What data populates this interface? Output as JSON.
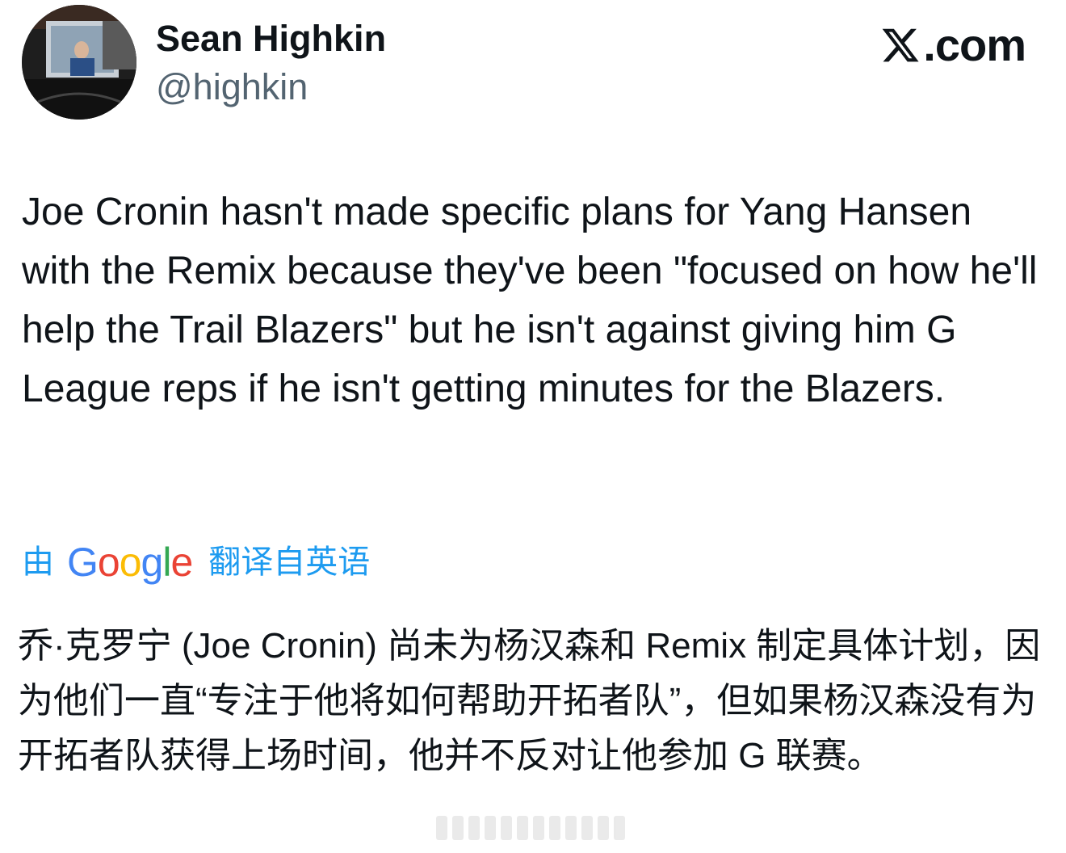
{
  "user": {
    "display_name": "Sean Highkin",
    "handle": "@highkin"
  },
  "brand": {
    "site": ".com",
    "logo_icon": "x-logo-icon"
  },
  "tweet": {
    "text": "Joe Cronin hasn't made specific plans for Yang Hansen with the Remix because they've been \"focused on how he'll help the Trail Blazers\" but he isn't against giving him G League reps if he isn't getting minutes for the Blazers."
  },
  "translation": {
    "prefix": "由",
    "provider_letters": [
      "G",
      "o",
      "o",
      "g",
      "l",
      "e"
    ],
    "suffix": "翻译自英语",
    "text": "乔·克罗宁 (Joe Cronin) 尚未为杨汉森和 Remix 制定具体计划，因为他们一直“专注于他将如何帮助开拓者队”，但如果杨汉森没有为开拓者队获得上场时间，他并不反对让他参加 G 联赛。"
  },
  "colors": {
    "text": "#0f1419",
    "handle": "#536471",
    "translate_link": "#1d9bf0",
    "google_blue": "#4285f4",
    "google_red": "#ea4335",
    "google_yellow": "#fbbc05",
    "google_green": "#34a853"
  }
}
